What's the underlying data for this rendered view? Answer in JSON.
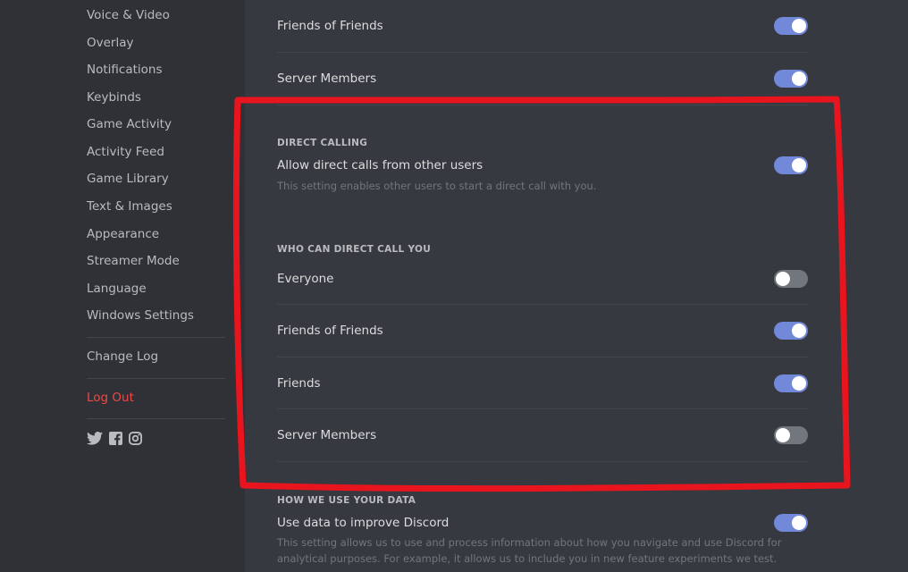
{
  "sidebar": {
    "items": [
      {
        "label": "Voice & Video"
      },
      {
        "label": "Overlay"
      },
      {
        "label": "Notifications"
      },
      {
        "label": "Keybinds"
      },
      {
        "label": "Game Activity"
      },
      {
        "label": "Activity Feed"
      },
      {
        "label": "Game Library"
      },
      {
        "label": "Text & Images"
      },
      {
        "label": "Appearance"
      },
      {
        "label": "Streamer Mode"
      },
      {
        "label": "Language"
      },
      {
        "label": "Windows Settings"
      }
    ],
    "change_log": "Change Log",
    "log_out": "Log Out",
    "social_icons": [
      "twitter-icon",
      "facebook-icon",
      "instagram-icon"
    ]
  },
  "top_rows": [
    {
      "label": "Friends of Friends",
      "enabled": true
    },
    {
      "label": "Server Members",
      "enabled": true
    }
  ],
  "direct_calling": {
    "header": "DIRECT CALLING",
    "label": "Allow direct calls from other users",
    "description": "This setting enables other users to start a direct call with you.",
    "enabled": true
  },
  "who_can_call": {
    "header": "WHO CAN DIRECT CALL YOU",
    "options": [
      {
        "label": "Everyone",
        "enabled": false
      },
      {
        "label": "Friends of Friends",
        "enabled": true
      },
      {
        "label": "Friends",
        "enabled": true
      },
      {
        "label": "Server Members",
        "enabled": false
      }
    ]
  },
  "data_usage": {
    "header": "HOW WE USE YOUR DATA",
    "label": "Use data to improve Discord",
    "description": "This setting allows us to use and process information about how you navigate and use Discord for analytical purposes. For example, it allows us to include you in new feature experiments we test.",
    "enabled": true
  },
  "colors": {
    "accent": "#7289da",
    "toggle_off": "#72767d",
    "logout": "#f04747",
    "annotation": "#e8141e"
  }
}
